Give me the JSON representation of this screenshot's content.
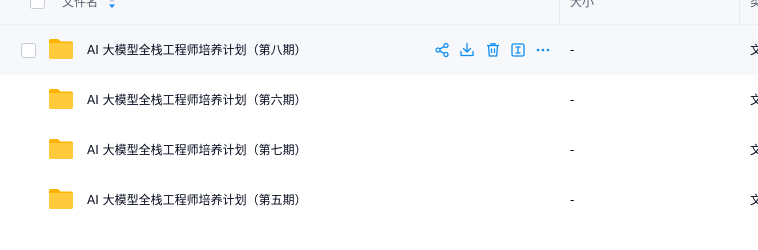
{
  "header": {
    "name_label": "文件名",
    "size_label": "大小",
    "type_label": "类"
  },
  "rows": [
    {
      "name": "AI 大模型全栈工程师培养计划（第八期）",
      "size": "-",
      "type": "文"
    },
    {
      "name": "AI 大模型全栈工程师培养计划（第六期）",
      "size": "-",
      "type": "文"
    },
    {
      "name": "AI 大模型全栈工程师培养计划（第七期）",
      "size": "-",
      "type": "文"
    },
    {
      "name": "AI 大模型全栈工程师培养计划（第五期）",
      "size": "-",
      "type": "文"
    }
  ],
  "colors": {
    "accent": "#0d8df2",
    "folder": "#ffc629",
    "hover_row": "#f6f8fc"
  },
  "icons": {
    "row_actions": [
      "share-icon",
      "download-icon",
      "delete-icon",
      "rename-icon",
      "more-icon"
    ],
    "folder": "folder-icon",
    "sort": "sort-icon"
  }
}
